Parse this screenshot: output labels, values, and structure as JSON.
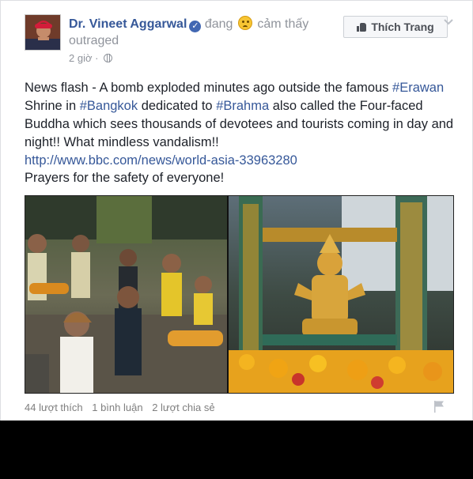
{
  "post": {
    "author": "Dr. Vineet Aggarwal",
    "verified_icon": "check-badge-icon",
    "feeling_prefix": "đang",
    "feeling_icon": "angry-face-emoji",
    "feeling_text": "cảm thấy outraged",
    "timestamp": "2 giờ",
    "privacy_icon": "globe-icon",
    "like_page_label": "Thích Trang",
    "text_1": "News flash - A bomb exploded minutes ago outside the famous ",
    "tag_1": "#Erawan",
    "text_2": " Shrine in ",
    "tag_2": "#Bangkok",
    "text_3": " dedicated to ",
    "tag_3": "#Brahma",
    "text_4": " also called the Four-faced Buddha which sees thousands of devotees and tourists coming in day and night!! What mindless vandalism!!",
    "link": "http://www.bbc.com/news/world-asia-33963280",
    "prayer": "Prayers for the safety of everyone!"
  },
  "stats": {
    "likes": "44 lượt thích",
    "comments": "1 bình luận",
    "shares": "2 lượt chia sẻ"
  },
  "colors": {
    "link_blue": "#365899",
    "muted_gray": "#90949c",
    "bar": "#000000"
  }
}
